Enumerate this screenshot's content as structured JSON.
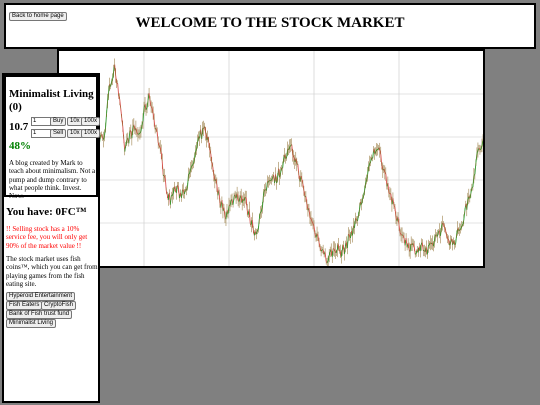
{
  "header": {
    "back_button": "Back to home page",
    "title": "WELCOME TO THE STOCK MARKET"
  },
  "stock": {
    "name": "Minimalist Living",
    "owned": "(0)",
    "price": "10.7",
    "change": "48%",
    "change_color": "#008000",
    "buy": {
      "quantity": "1",
      "label": "Buy",
      "x10": "10x",
      "x100": "100x"
    },
    "sell": {
      "quantity": "1",
      "label": "Sell",
      "x10": "10x",
      "x100": "100x"
    },
    "description": "A blog created by Mark to teach about minimalism. Not a pump and dump contrary to what people think. Invest. Now."
  },
  "wallet": {
    "balance": "You have: 0FC™"
  },
  "notices": {
    "warning": "!! Selling stock has a 10% service fee, you will only get 90% of the market value !!",
    "info": "The stock market uses fish coins™, which you can get from playing games from the fish eating site."
  },
  "stock_list": [
    "Hyperoid Entertainment",
    "Fish Eaters",
    "CryptoFish",
    "Bank of Fish trust fund",
    "Minimalist Living"
  ],
  "chart_data": {
    "type": "line",
    "up_color": "#2e9a2e",
    "down_color": "#d9534f",
    "wick_color": "#8b6b2a",
    "grid": true,
    "x": [
      0,
      5,
      10,
      15,
      20,
      25,
      30,
      35,
      40,
      45,
      50,
      55,
      60,
      65,
      70,
      75,
      80,
      85,
      90,
      95,
      100,
      105,
      110,
      115,
      120,
      125,
      130,
      135,
      140,
      145,
      150,
      155,
      160,
      165,
      170,
      175,
      180,
      185,
      190,
      195,
      200,
      205,
      210,
      215,
      220,
      225,
      230,
      235,
      240,
      245,
      250,
      255,
      260,
      265,
      270,
      275,
      280,
      285,
      290,
      295,
      300,
      305,
      310,
      315,
      320,
      325,
      330,
      335,
      340,
      345,
      350,
      355,
      360,
      365,
      370,
      375,
      380,
      385,
      390,
      395,
      400,
      405,
      410,
      415,
      420
    ],
    "y": [
      0.9,
      0.95,
      1.1,
      1.25,
      1.15,
      1.05,
      0.95,
      0.85,
      0.9,
      0.97,
      1.3,
      1.5,
      1.2,
      0.85,
      0.95,
      1.0,
      0.95,
      1.15,
      1.25,
      1.05,
      0.85,
      0.6,
      0.45,
      0.55,
      0.5,
      0.55,
      0.65,
      0.8,
      0.95,
      1.0,
      0.82,
      0.6,
      0.45,
      0.35,
      0.42,
      0.5,
      0.48,
      0.45,
      0.3,
      0.2,
      0.35,
      0.55,
      0.65,
      0.62,
      0.7,
      0.8,
      0.85,
      0.75,
      0.6,
      0.45,
      0.3,
      0.2,
      0.1,
      0.0,
      0.05,
      0.1,
      0.05,
      0.12,
      0.22,
      0.3,
      0.45,
      0.62,
      0.78,
      0.88,
      0.75,
      0.6,
      0.45,
      0.3,
      0.2,
      0.12,
      0.1,
      0.08,
      0.1,
      0.05,
      0.12,
      0.2,
      0.25,
      0.18,
      0.12,
      0.2,
      0.3,
      0.45,
      0.6,
      0.82,
      0.9
    ]
  }
}
